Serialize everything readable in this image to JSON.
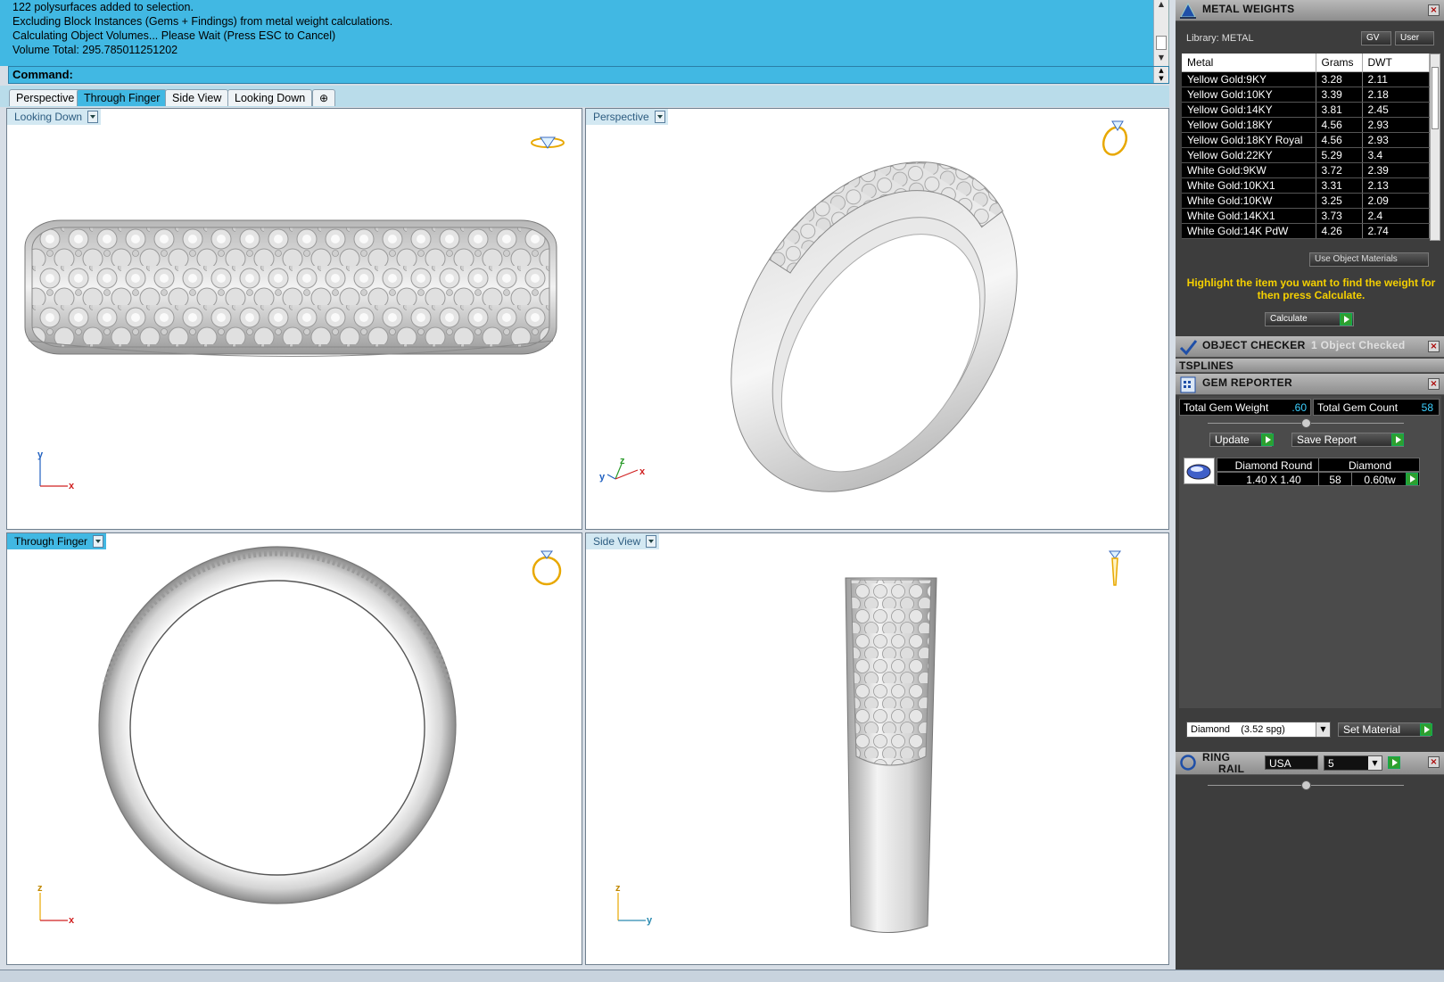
{
  "command_history": {
    "lines": [
      "122 polysurfaces added to selection.",
      "Excluding Block Instances (Gems + Findings) from metal weight calculations.",
      "Calculating Object Volumes... Please Wait (Press ESC to Cancel)",
      "Volume Total: 295.785011251202"
    ],
    "command_label": "Command:"
  },
  "view_tabs": [
    "Perspective",
    "Through Finger",
    "Side View",
    "Looking Down"
  ],
  "view_tab_active": "Through Finger",
  "add_tab_symbol": "⊕",
  "viewports": {
    "top_left": {
      "title": "Looking Down",
      "axis": [
        "y",
        "x"
      ]
    },
    "top_right": {
      "title": "Perspective",
      "axis": [
        "y",
        "z",
        "x"
      ]
    },
    "bottom_left": {
      "title": "Through Finger",
      "axis": [
        "z",
        "x"
      ]
    },
    "bottom_right": {
      "title": "Side View",
      "axis": [
        "z",
        "y"
      ]
    }
  },
  "metal_weights": {
    "title": "METAL WEIGHTS",
    "library": "Library: METAL",
    "gv": "GV",
    "user": "User",
    "columns": [
      "Metal",
      "Grams",
      "DWT"
    ],
    "rows": [
      [
        "Yellow Gold:9KY",
        "3.28",
        "2.11"
      ],
      [
        "Yellow Gold:10KY",
        "3.39",
        "2.18"
      ],
      [
        "Yellow Gold:14KY",
        "3.81",
        "2.45"
      ],
      [
        "Yellow Gold:18KY",
        "4.56",
        "2.93"
      ],
      [
        "Yellow Gold:18KY Royal",
        "4.56",
        "2.93"
      ],
      [
        "Yellow Gold:22KY",
        "5.29",
        "3.4"
      ],
      [
        "White Gold:9KW",
        "3.72",
        "2.39"
      ],
      [
        "White Gold:10KX1",
        "3.31",
        "2.13"
      ],
      [
        "White Gold:10KW",
        "3.25",
        "2.09"
      ],
      [
        "White Gold:14KX1",
        "3.73",
        "2.4"
      ],
      [
        "White Gold:14K PdW",
        "4.26",
        "2.74"
      ]
    ],
    "use_object_materials": "Use Object Materials",
    "hint": "Highlight the item you want to find the weight for then press Calculate.",
    "calculate": "Calculate"
  },
  "object_checker": {
    "title": "OBJECT CHECKER",
    "status": "1  Object Checked"
  },
  "tsplines": {
    "title": "TSPLINES"
  },
  "gem_reporter": {
    "title": "GEM REPORTER",
    "total_weight_label": "Total Gem Weight",
    "total_weight_value": ".60",
    "total_count_label": "Total Gem Count",
    "total_count_value": "58",
    "update": "Update",
    "save_report": "Save Report",
    "gem_header_1": "Diamond Round",
    "gem_header_2": "Diamond",
    "gem_size": "1.40 X 1.40",
    "gem_count": "58",
    "gem_weight": "0.60tw",
    "material_select": "Diamond    (3.52 spg)",
    "set_material": "Set Material"
  },
  "ring_rail": {
    "title_1": "RING",
    "title_2": "RAIL",
    "region": "USA",
    "size": "5"
  },
  "colors": {
    "accent": "#41b8e3",
    "panel": "#3d3d3d",
    "hint": "#f5d000",
    "go": "#2ea02e"
  }
}
